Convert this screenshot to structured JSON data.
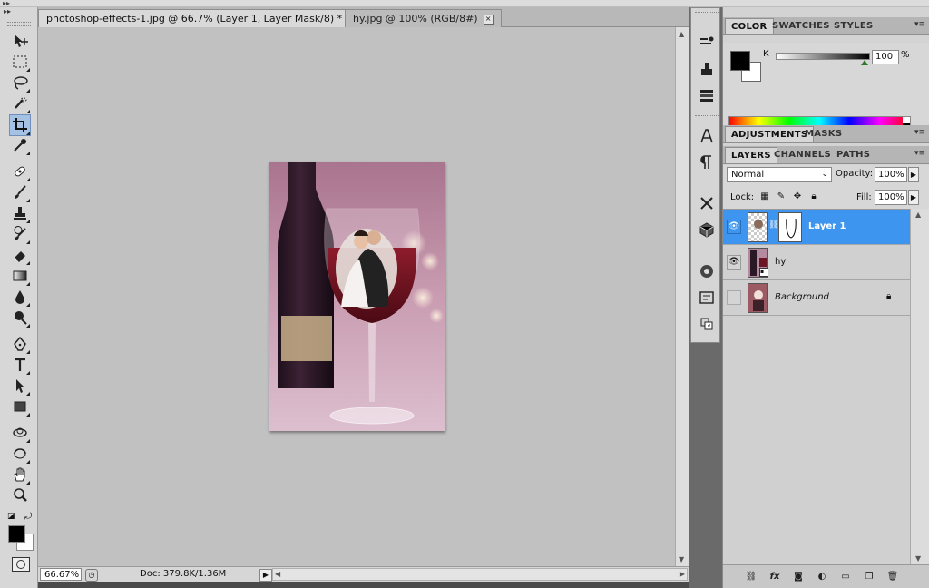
{
  "tabs": [
    {
      "label": "photoshop-effects-1.jpg @ 66.7% (Layer 1, Layer Mask/8) *",
      "close": "×"
    },
    {
      "label": "hy.jpg @ 100% (RGB/8#)",
      "close": "×"
    }
  ],
  "toolbar": {
    "collapse": "▸▸",
    "tools": [
      "move-tool-icon",
      "marquee-tool-icon",
      "lasso-tool-icon",
      "quick-selection-tool-icon",
      "crop-tool-icon",
      "eyedropper-tool-icon",
      "spot-healing-tool-icon",
      "brush-tool-icon",
      "clone-stamp-tool-icon",
      "history-brush-tool-icon",
      "eraser-tool-icon",
      "gradient-tool-icon",
      "blur-tool-icon",
      "dodge-tool-icon",
      "pen-tool-icon",
      "type-tool-icon",
      "path-selection-tool-icon",
      "rectangle-tool-icon",
      "3d-rotate-tool-icon",
      "3d-orbit-tool-icon",
      "hand-tool-icon",
      "zoom-tool-icon"
    ],
    "active_tool": "crop-tool-icon",
    "foreground_color": "#000000",
    "background_color": "#ffffff"
  },
  "status": {
    "zoom": "66.67%",
    "doc": "Doc: 379.8K/1.36M"
  },
  "dock": {
    "icons": [
      "tool-presets-icon",
      "clone-source-icon",
      "history-icon",
      "character-icon",
      "paragraph-icon",
      "tools-icon",
      "3d-icon",
      "navigator-icon",
      "info-icon",
      "actions-icon"
    ]
  },
  "color_panel": {
    "tabs": [
      "COLOR",
      "SWATCHES",
      "STYLES"
    ],
    "channel_label": "K",
    "k_value": "100",
    "unit": "%",
    "k_level_percent": 100
  },
  "adjustments_panel": {
    "tabs": [
      "ADJUSTMENTS",
      "MASKS"
    ]
  },
  "layers_panel": {
    "tabs": [
      "LAYERS",
      "CHANNELS",
      "PATHS"
    ],
    "blend_mode": "Normal",
    "opacity_label": "Opacity:",
    "opacity_value": "100%",
    "lock_label": "Lock:",
    "fill_label": "Fill:",
    "fill_value": "100%",
    "layers": [
      {
        "name": "Layer 1",
        "visible": true,
        "selected": true
      },
      {
        "name": "hy",
        "visible": true,
        "selected": false
      },
      {
        "name": "Background",
        "visible": false,
        "selected": false,
        "locked": true
      }
    ],
    "footer_icons": [
      "link-layers-icon",
      "layer-style-icon",
      "add-mask-icon",
      "adjustment-layer-icon",
      "new-group-icon",
      "new-layer-icon",
      "delete-layer-icon"
    ],
    "footer_fx": "fx"
  },
  "colors": {
    "selection_blue": "#3d95ef",
    "canvas_gray": "#c1c1c1"
  }
}
